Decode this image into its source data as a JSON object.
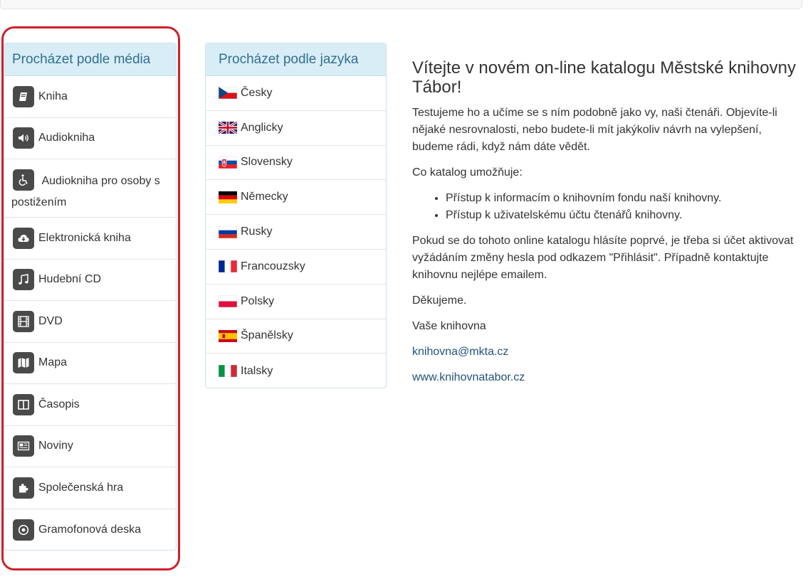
{
  "media_panel": {
    "title": "Procházet podle média",
    "items": [
      {
        "label": "Kniha",
        "icon": "book-icon"
      },
      {
        "label": "Audiokniha",
        "icon": "speaker-icon"
      },
      {
        "label": "Audiokniha pro osoby s postižením",
        "icon": "wheelchair-icon"
      },
      {
        "label": "Elektronická kniha",
        "icon": "cloud-download-icon"
      },
      {
        "label": "Hudební CD",
        "icon": "music-note-icon"
      },
      {
        "label": "DVD",
        "icon": "film-icon"
      },
      {
        "label": "Mapa",
        "icon": "map-icon"
      },
      {
        "label": "Časopis",
        "icon": "magazine-icon"
      },
      {
        "label": "Noviny",
        "icon": "newspaper-icon"
      },
      {
        "label": "Společenská hra",
        "icon": "puzzle-icon"
      },
      {
        "label": "Gramofonová deska",
        "icon": "vinyl-record-icon"
      }
    ]
  },
  "language_panel": {
    "title": "Procházet podle jazyka",
    "items": [
      {
        "label": "Česky",
        "flag": "czech-flag-icon"
      },
      {
        "label": "Anglicky",
        "flag": "uk-flag-icon"
      },
      {
        "label": "Slovensky",
        "flag": "slovak-flag-icon"
      },
      {
        "label": "Německy",
        "flag": "german-flag-icon"
      },
      {
        "label": "Rusky",
        "flag": "russian-flag-icon"
      },
      {
        "label": "Francouzsky",
        "flag": "french-flag-icon"
      },
      {
        "label": "Polsky",
        "flag": "polish-flag-icon"
      },
      {
        "label": "Španělsky",
        "flag": "spanish-flag-icon"
      },
      {
        "label": "Italsky",
        "flag": "italian-flag-icon"
      }
    ]
  },
  "welcome": {
    "heading": "Vítejte v novém on-line katalogu Městské knihovny Tábor!",
    "intro": "Testujeme ho a učíme se s ním podobně jako vy, naši čtenáři. Objevíte-li nějaké nesrovnalosti, nebo budete-li mít jakýkoliv návrh na vylepšení, budeme rádi, když nám dáte vědět.",
    "features_label": "Co katalog umožňuje:",
    "features": [
      "Přístup k informacím o knihovním fondu naší knihovny.",
      "Přístup k uživatelskému účtu čtenářů knihovny."
    ],
    "login_note": "Pokud se do tohoto online katalogu hlásíte poprvé, je třeba si účet aktivovat vyžádáním změny hesla pod odkazem \"Přihlásit\". Případně kontaktujte knihovnu nejlépe emailem.",
    "thanks": "Děkujeme.",
    "signature": "Vaše knihovna",
    "email": "knihovna@mkta.cz",
    "website": "www.knihovnatabor.cz"
  },
  "colors": {
    "panel_heading_bg": "#d9edf7",
    "panel_heading_text": "#31708f",
    "highlight_border": "#d0202a",
    "link": "#23527c",
    "icon_bg": "#4a4a4a"
  }
}
